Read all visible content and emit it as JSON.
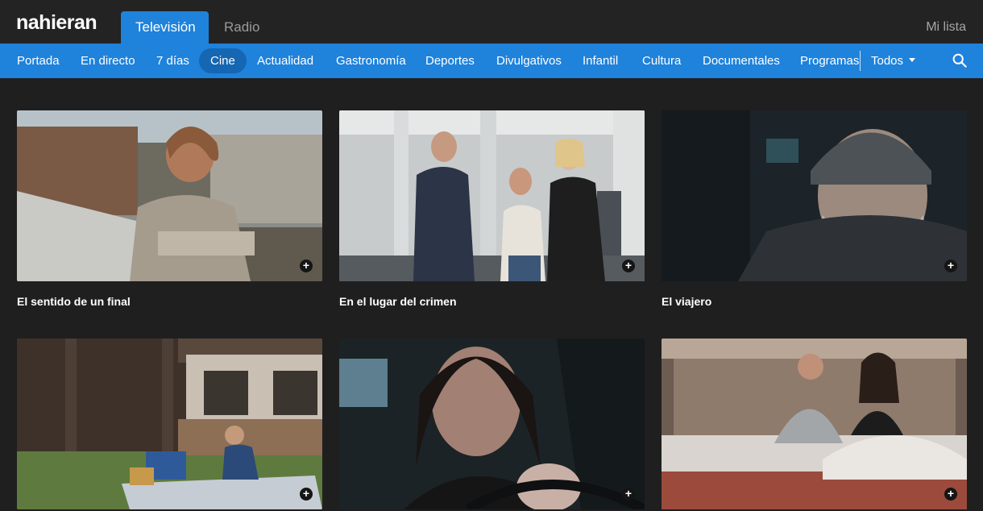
{
  "brand": "nahieran",
  "main_tabs": [
    {
      "label": "Televisión",
      "active": true
    },
    {
      "label": "Radio",
      "active": false
    }
  ],
  "my_list": "Mi lista",
  "nav": {
    "items": [
      "Portada",
      "En directo",
      "7 días",
      "Cine",
      "Actualidad",
      "Gastronomía",
      "Deportes",
      "Divulgativos",
      "Infantil",
      "Cultura",
      "Documentales",
      "Programas"
    ],
    "active": "Cine",
    "all_label": "Todos"
  },
  "icons": {
    "search": "search-icon",
    "add": "plus-icon",
    "dropdown": "chevron-down-icon"
  },
  "colors": {
    "accent": "#1f82db",
    "accent_active_pill": "#1566b3",
    "background": "#1f1f1f",
    "topbar": "#232323"
  },
  "add_symbol": "+",
  "cards": [
    {
      "title": "El sentido de un final"
    },
    {
      "title": "En el lugar del crimen"
    },
    {
      "title": "El viajero"
    },
    {
      "title": ""
    },
    {
      "title": ""
    },
    {
      "title": ""
    }
  ]
}
